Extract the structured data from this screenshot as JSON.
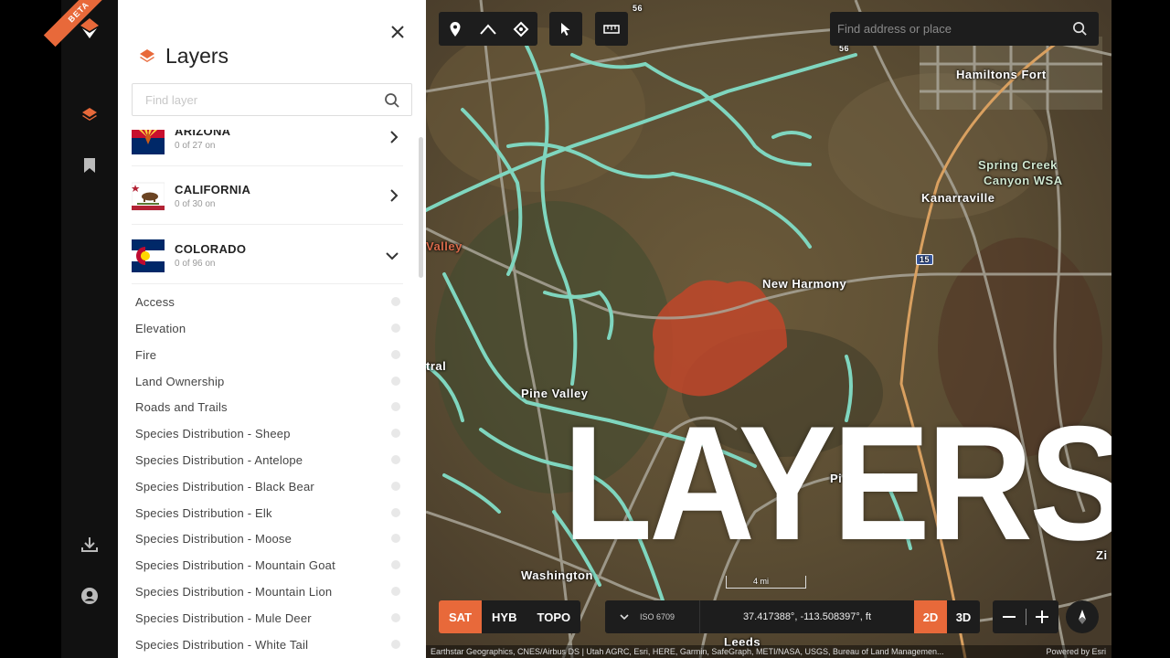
{
  "rail": {
    "badge": "BETA",
    "icons": [
      "logo-icon",
      "layers-icon",
      "bookmark-icon",
      "download-icon",
      "account-icon"
    ]
  },
  "panel": {
    "title": "Layers",
    "search_placeholder": "Find layer",
    "states": [
      {
        "name": "ARIZONA",
        "count": "0 of 27 on",
        "expanded": false
      },
      {
        "name": "CALIFORNIA",
        "count": "0 of 30 on",
        "expanded": false
      },
      {
        "name": "COLORADO",
        "count": "0 of 96 on",
        "expanded": true
      }
    ],
    "colorado_layers": [
      "Access",
      "Elevation",
      "Fire",
      "Land Ownership",
      "Roads and Trails",
      "Species Distribution - Sheep",
      "Species Distribution - Antelope",
      "Species Distribution - Black Bear",
      "Species Distribution - Elk",
      "Species Distribution - Moose",
      "Species Distribution - Mountain Goat",
      "Species Distribution - Mountain Lion",
      "Species Distribution - Mule Deer",
      "Species Distribution - White Tail"
    ]
  },
  "map": {
    "search_placeholder": "Find address or place",
    "overlay_title": "LAYERS",
    "labels": {
      "hamiltons_fort": "Hamiltons Fort",
      "spring_creek": "Spring Creek",
      "canyon_wsa": "Canyon WSA",
      "kanarraville": "Kanarraville",
      "new_harmony": "New Harmony",
      "pine_valley": "Pine Valley",
      "washington": "Washington",
      "leeds": "Leeds",
      "valley": "Valley",
      "tral": "tral",
      "pi": "Pi",
      "zi": "Zi",
      "route_56_top": "56",
      "route_56_right": "56",
      "interstate": "15"
    },
    "basemap": {
      "options": [
        "SAT",
        "HYB",
        "TOPO"
      ],
      "active": "SAT"
    },
    "coord_system": "ISO 6709",
    "coordinates": "37.417388°, -113.508397°, ft",
    "dimension": {
      "options": [
        "2D",
        "3D"
      ],
      "active": "2D"
    },
    "scale": "4 mi",
    "attribution": "Earthstar Geographics, CNES/Airbus DS | Utah AGRC, Esri, HERE, Garmin, SafeGraph, METI/NASA, USGS, Bureau of Land Managemen...",
    "powered_by": "Powered by Esri"
  },
  "colors": {
    "accent": "#e8693a",
    "trail": "#7fd6bf",
    "fire_area": "#c0472a",
    "toolbar_bg": "#1d1d1d"
  }
}
